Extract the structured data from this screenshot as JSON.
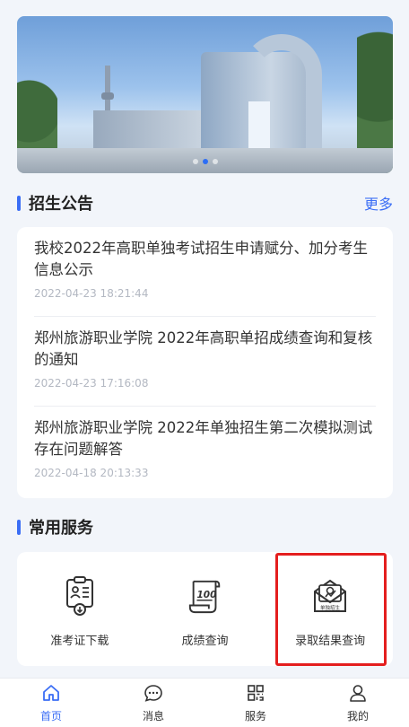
{
  "banner": {
    "image": "campus-building-photo",
    "slide_count": 3,
    "active_slide": 2
  },
  "announcements": {
    "title": "招生公告",
    "more": "更多",
    "items": [
      {
        "title": "我校2022年高职单独考试招生申请赋分、加分考生信息公示",
        "time": "2022-04-23 18:21:44"
      },
      {
        "title": "郑州旅游职业学院 2022年高职单招成绩查询和复核的通知",
        "time": "2022-04-23 17:16:08"
      },
      {
        "title": "郑州旅游职业学院 2022年单独招生第二次模拟测试存在问题解答",
        "time": "2022-04-18 20:13:33"
      }
    ]
  },
  "services": {
    "title": "常用服务",
    "items": [
      {
        "label": "准考证下载",
        "icon": "admission-ticket-icon"
      },
      {
        "label": "成绩查询",
        "icon": "score-scroll-icon"
      },
      {
        "label": "录取结果查询",
        "icon": "admission-envelope-icon",
        "icon_text": "单独招生"
      }
    ]
  },
  "tabbar": {
    "tabs": [
      {
        "label": "首页",
        "icon": "home-icon",
        "active": true
      },
      {
        "label": "消息",
        "icon": "message-icon"
      },
      {
        "label": "服务",
        "icon": "grid-icon"
      },
      {
        "label": "我的",
        "icon": "user-icon"
      }
    ]
  },
  "colors": {
    "accent": "#3b6ef5",
    "highlight": "#e41e1e",
    "background": "#f2f5fa"
  }
}
